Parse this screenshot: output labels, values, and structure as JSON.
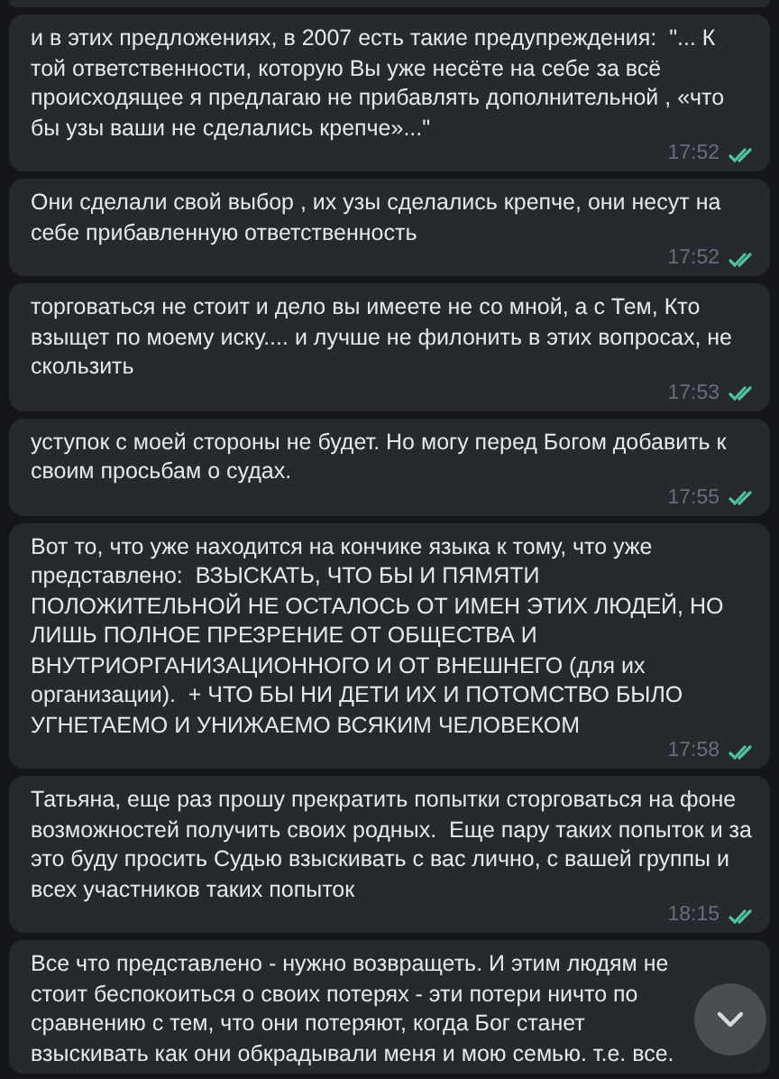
{
  "messages": [
    {
      "text": "и в этих предложениях, в 2007 есть такие предупреждения:  \"... К той ответственности, которую Вы уже несёте на себе за всё происходящее я предлагаю не прибавлять дополнительной , «что бы узы ваши не сделались крепче»...\"",
      "time": "17:52",
      "read": true
    },
    {
      "text": "Они сделали свой выбор , их узы сделались крепче, они несут на себе прибавленную ответственность",
      "time": "17:52",
      "read": true
    },
    {
      "text": "торговаться не стоит и дело вы имеете не со мной, а с Тем, Кто взыщет по моему иску.... и лучше не филонить в этих вопросах, не скользить",
      "time": "17:53",
      "read": true
    },
    {
      "text": "уступок с моей стороны не будет. Но могу перед Богом добавить к своим просьбам о судах.",
      "time": "17:55",
      "read": true
    },
    {
      "text": "Вот то, что уже находится на кончике языка к тому, что уже представлено:  ВЗЫСКАТЬ, ЧТО БЫ И ПЯМЯТИ ПОЛОЖИТЕЛЬНОЙ НЕ ОСТАЛОСЬ ОТ ИМЕН ЭТИХ ЛЮДЕЙ, НО ЛИШЬ ПОЛНОЕ ПРЕЗРЕНИЕ ОТ ОБЩЕСТВА И ВНУТРИОРГАНИЗАЦИОННОГО И ОТ ВНЕШНЕГО (для их организации).  + ЧТО БЫ НИ ДЕТИ ИХ И ПОТОМСТВО БЫЛО УГНЕТАЕМО И УНИЖАЕМО ВСЯКИМ ЧЕЛОВЕКОМ",
      "time": "17:58",
      "read": true
    },
    {
      "text": "Татьяна, еще раз прошу прекратить попытки сторговаться на фоне возможностей получить своих родных.  Еще пару таких попыток и за это буду просить Судью взыскивать с вас лично, с вашей группы и всех участников таких попыток",
      "time": "18:15",
      "read": true
    },
    {
      "text": "Все что представлено - нужно возвращеть. И этим людям не стоит беспокоиться о своих потерях - эти потери ничто по сравнению с тем, что они потеряют, когда Бог станет взыскивать как они обкрадывали меня и мою семью. т.е. все."
    }
  ]
}
